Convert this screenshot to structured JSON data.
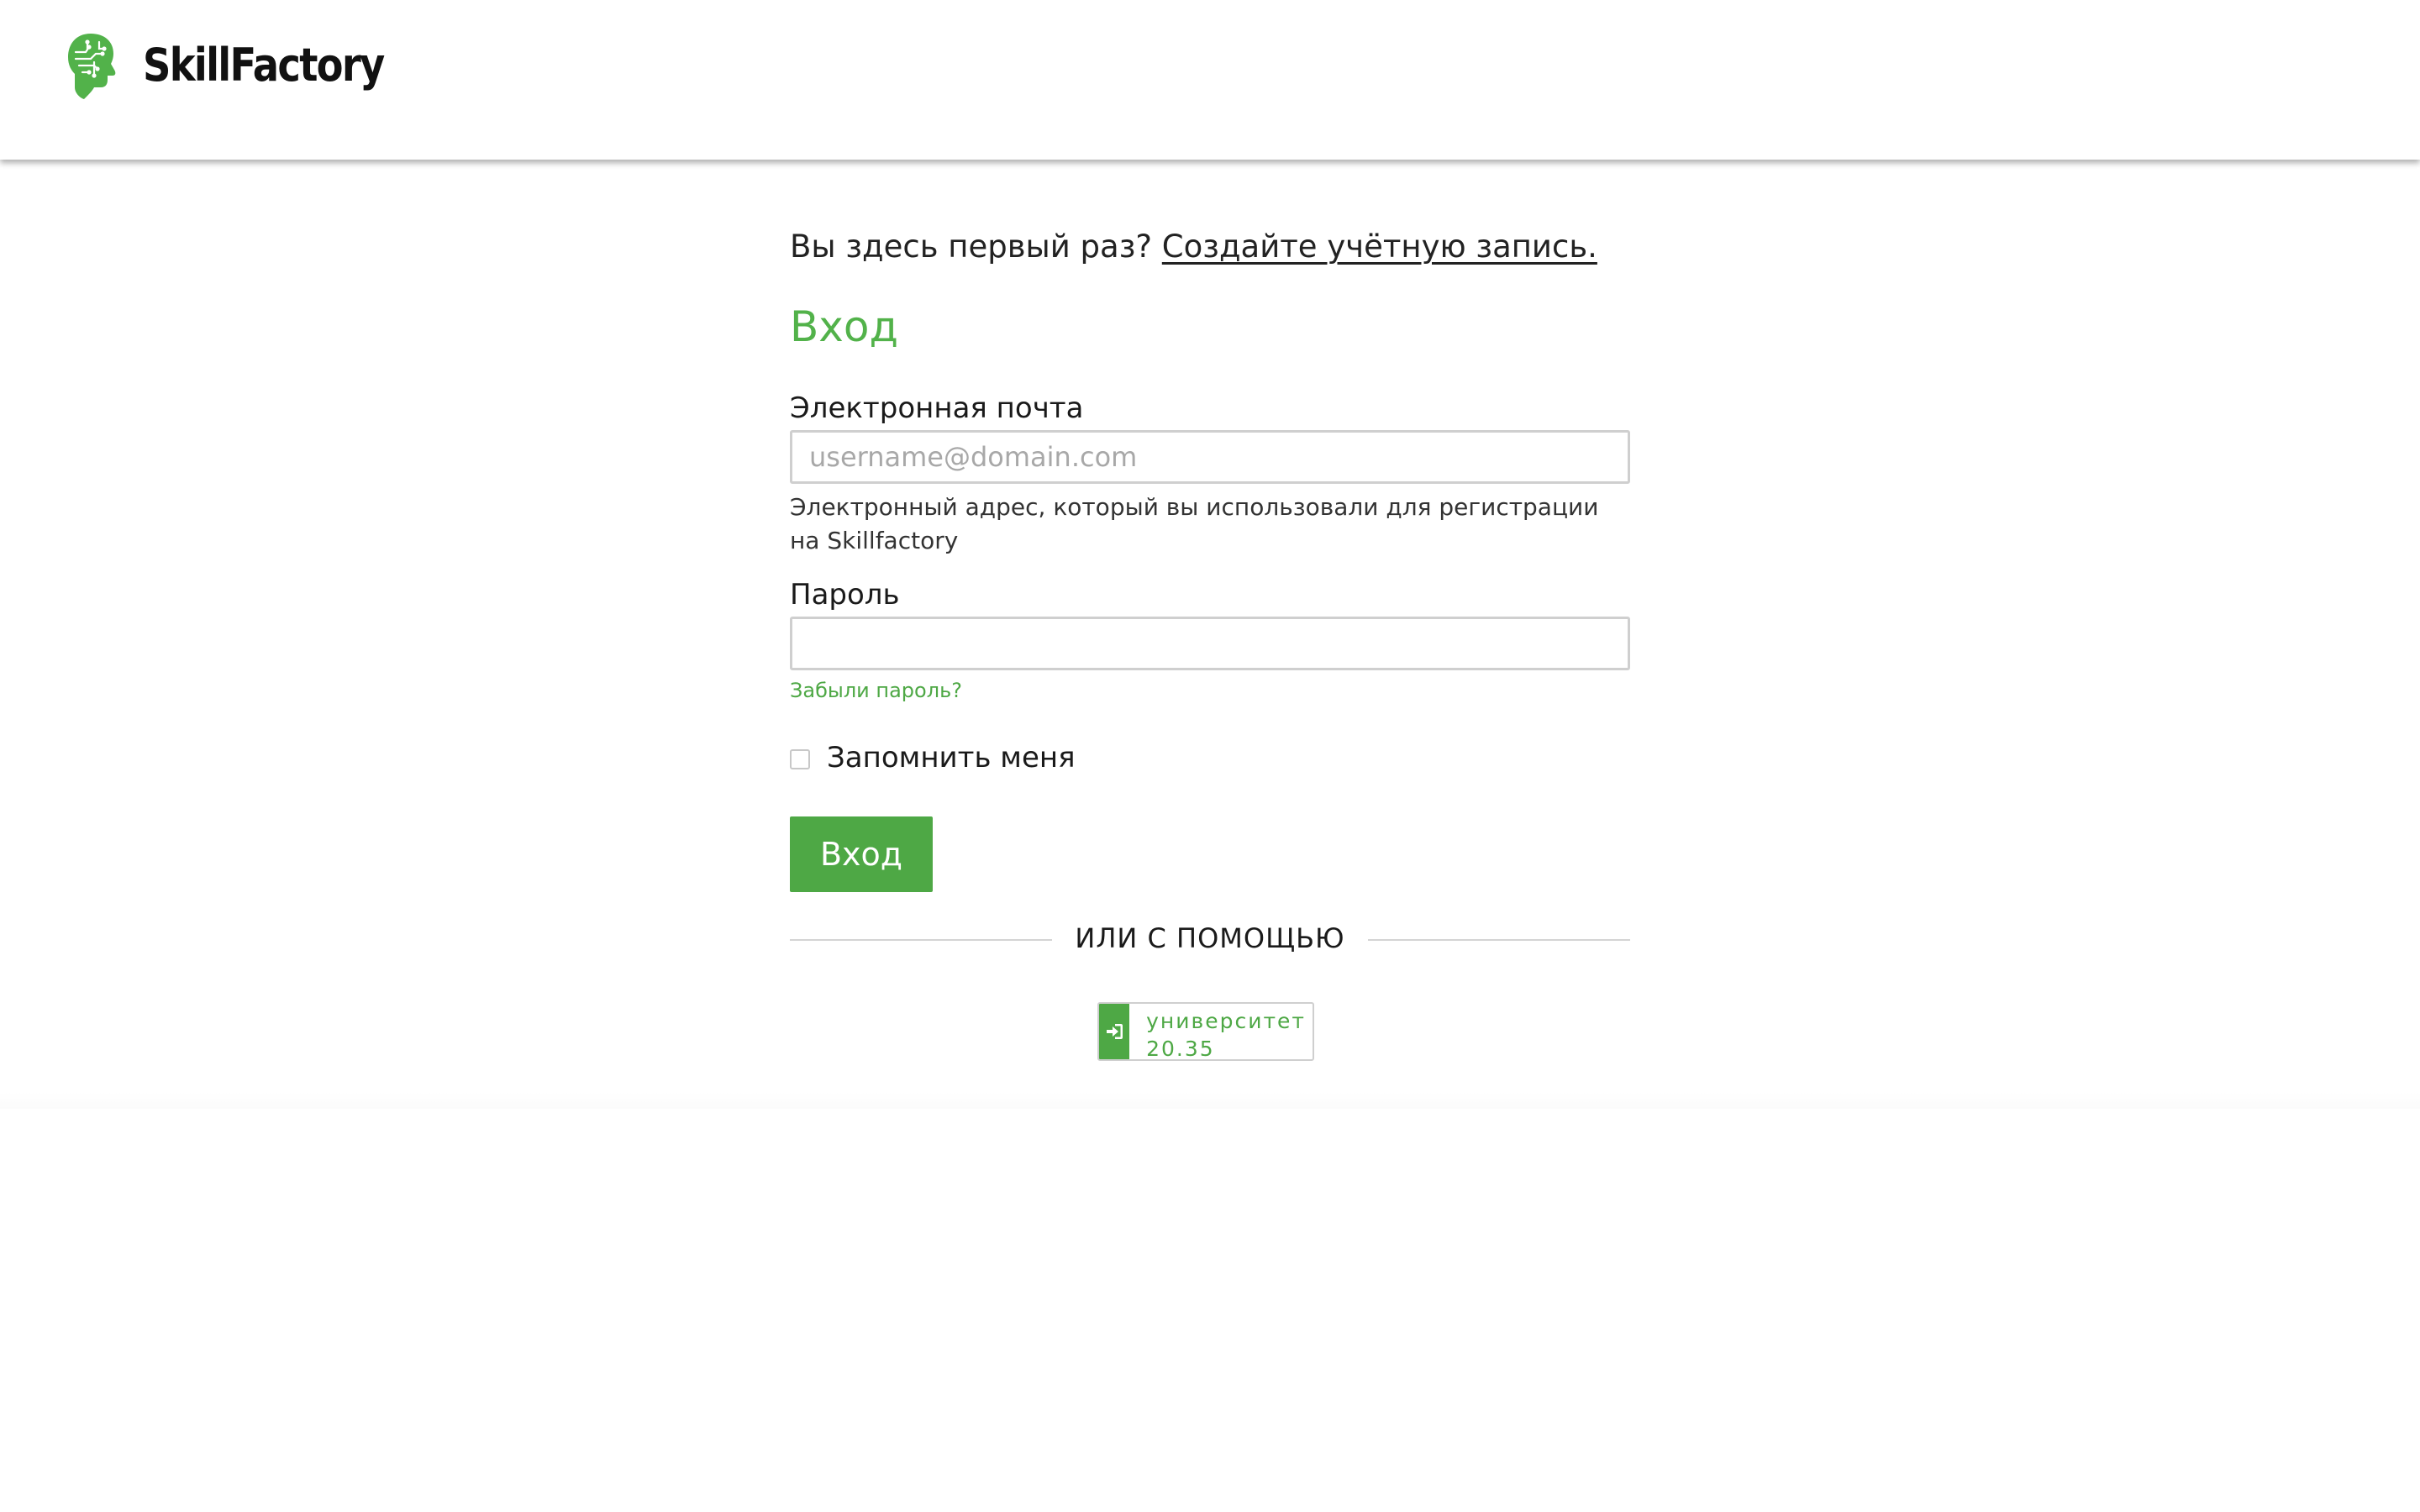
{
  "header": {
    "logo_text": "SkillFactory",
    "logo_icon": "brain-head-icon"
  },
  "login": {
    "first_time_text": "Вы здесь первый раз?",
    "create_account_link": "Создайте учётную запись.",
    "title": "Вход",
    "email_label": "Электронная почта",
    "email_placeholder": "username@domain.com",
    "email_value": "",
    "email_help": "Электронный адрес, который вы использовали для регистрации на Skillfactory",
    "password_label": "Пароль",
    "password_value": "",
    "forgot_password": "Забыли пароль?",
    "remember_me": "Запомнить меня",
    "remember_checked": false,
    "submit_label": "Вход",
    "divider_text": "ИЛИ С ПОМОЩЬЮ",
    "sso_label": "университет\n20.35",
    "sso_icon": "sign-in-icon"
  },
  "colors": {
    "brand_green": "#4ea845",
    "title_green": "#52b24a",
    "input_border": "#cfcfcf"
  }
}
